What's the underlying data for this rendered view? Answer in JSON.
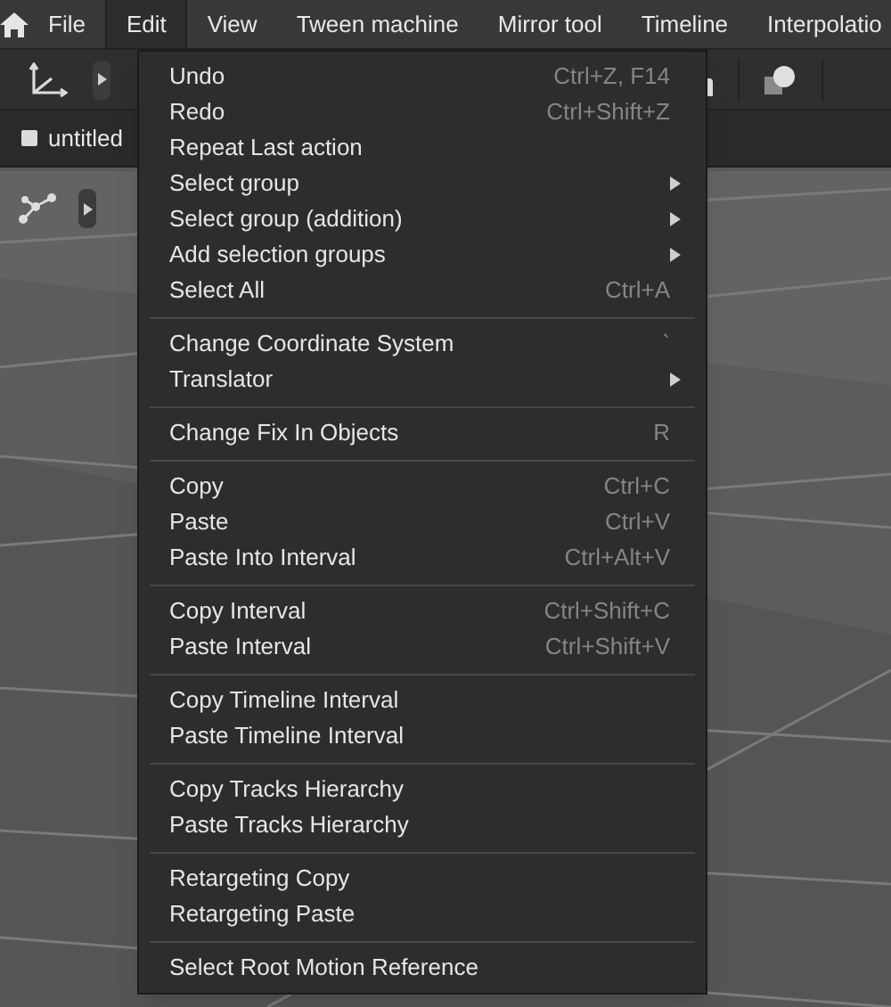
{
  "menubar": [
    {
      "label": "File",
      "selected": false
    },
    {
      "label": "Edit",
      "selected": true
    },
    {
      "label": "View",
      "selected": false
    },
    {
      "label": "Tween machine",
      "selected": false
    },
    {
      "label": "Mirror tool",
      "selected": false
    },
    {
      "label": "Timeline",
      "selected": false
    },
    {
      "label": "Interpolatio",
      "selected": false
    }
  ],
  "document_tab": {
    "label": "untitled"
  },
  "edit_menu": {
    "groups": [
      [
        {
          "label": "Undo",
          "shortcut": "Ctrl+Z, F14",
          "kind": "command"
        },
        {
          "label": "Redo",
          "shortcut": "Ctrl+Shift+Z",
          "kind": "command"
        },
        {
          "label": "Repeat Last action",
          "kind": "command"
        },
        {
          "label": "Select group",
          "kind": "submenu"
        },
        {
          "label": "Select group (addition)",
          "kind": "submenu"
        },
        {
          "label": "Add selection groups",
          "kind": "submenu"
        },
        {
          "label": "Select All",
          "shortcut": "Ctrl+A",
          "kind": "command"
        }
      ],
      [
        {
          "label": "Change Coordinate System",
          "shortcut": "`",
          "kind": "command"
        },
        {
          "label": "Translator",
          "kind": "submenu"
        }
      ],
      [
        {
          "label": "Change Fix In Objects",
          "shortcut": "R",
          "kind": "command"
        }
      ],
      [
        {
          "label": "Copy",
          "shortcut": "Ctrl+C",
          "kind": "command"
        },
        {
          "label": "Paste",
          "shortcut": "Ctrl+V",
          "kind": "command"
        },
        {
          "label": "Paste Into Interval",
          "shortcut": "Ctrl+Alt+V",
          "kind": "command"
        }
      ],
      [
        {
          "label": "Copy Interval",
          "shortcut": "Ctrl+Shift+C",
          "kind": "command"
        },
        {
          "label": "Paste Interval",
          "shortcut": "Ctrl+Shift+V",
          "kind": "command"
        }
      ],
      [
        {
          "label": "Copy Timeline Interval",
          "kind": "command"
        },
        {
          "label": "Paste Timeline Interval",
          "kind": "command"
        }
      ],
      [
        {
          "label": "Copy Tracks Hierarchy",
          "kind": "command"
        },
        {
          "label": "Paste Tracks Hierarchy",
          "kind": "command"
        }
      ],
      [
        {
          "label": "Retargeting Copy",
          "kind": "command"
        },
        {
          "label": "Retargeting Paste",
          "kind": "command"
        }
      ],
      [
        {
          "label": "Select Root Motion Reference",
          "kind": "command"
        }
      ]
    ]
  }
}
